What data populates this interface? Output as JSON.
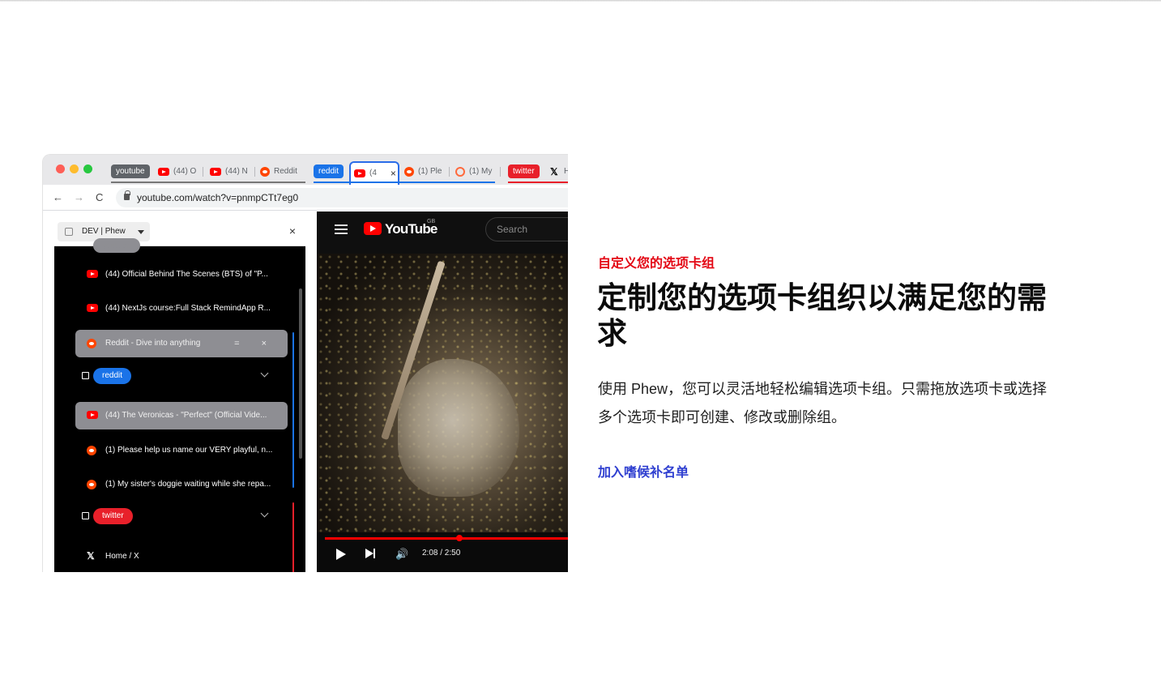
{
  "browser": {
    "tabs": [
      {
        "type": "group-chip",
        "label": "youtube",
        "color": "#555555"
      },
      {
        "type": "tab",
        "icon": "youtube-icon",
        "label": "(44) O"
      },
      {
        "type": "tab",
        "icon": "youtube-icon",
        "label": "(44) N"
      },
      {
        "type": "tab",
        "icon": "reddit-icon",
        "label": "Reddit"
      },
      {
        "type": "group-chip",
        "label": "reddit",
        "color": "#1a73e8"
      },
      {
        "type": "active-tab",
        "icon": "youtube-icon",
        "label": "(4",
        "close": "×"
      },
      {
        "type": "tab",
        "icon": "reddit-icon",
        "label": "(1) Ple"
      },
      {
        "type": "tab",
        "icon": "reddit-icon",
        "label": "(1) My"
      },
      {
        "type": "group-chip",
        "label": "twitter",
        "color": "#e8202a"
      },
      {
        "type": "tab",
        "icon": "x-icon",
        "label": "H"
      }
    ],
    "url": "youtube.com/watch?v=pnmpCTt7eg0",
    "nav": {
      "back": "←",
      "forward": "→",
      "reload": "C"
    }
  },
  "side_panel": {
    "workspace": "DEV | Phew",
    "close": "×",
    "rows": [
      {
        "icon": "youtube-icon",
        "label": "(44) Official Behind The Scenes (BTS) of \"P...",
        "highlight": false
      },
      {
        "icon": "youtube-icon",
        "label": "(44) NextJs course:Full Stack RemindApp R...",
        "highlight": false
      },
      {
        "icon": "reddit-icon",
        "label": "Reddit - Dive into anything",
        "highlight": true,
        "actions": "= ×"
      },
      {
        "icon": "youtube-icon",
        "label": "(44) The Veronicas - \"Perfect\" (Official Vide...",
        "highlight": true
      },
      {
        "icon": "reddit-icon",
        "label": "(1) Please help us name our VERY playful, n...",
        "highlight": false
      },
      {
        "icon": "reddit-icon",
        "label": "(1) My sister's doggie waiting while she repa...",
        "highlight": false
      },
      {
        "icon": "x-icon",
        "label": "Home / X",
        "highlight": false
      }
    ],
    "groups": [
      {
        "label": "youtube",
        "color": "#8e8e93"
      },
      {
        "label": "reddit",
        "color": "#1a73e8"
      },
      {
        "label": "twitter",
        "color": "#e8202a"
      }
    ]
  },
  "youtube": {
    "logo_text": "YouTube",
    "region": "GB",
    "search_placeholder": "Search",
    "time": "2:08 / 2:50",
    "progress_fraction": 0.55
  },
  "copy": {
    "eyebrow": "自定义您的选项卡组",
    "heading": "定制您的选项卡组织以满足您的需求",
    "body": "使用 Phew，您可以灵活地轻松编辑选项卡组。只需拖放选项卡或选择多个选项卡即可创建、修改或删除组。",
    "cta": "加入嗜候补名单"
  },
  "colors": {
    "accent_red": "#e30613",
    "cta_blue": "#2f3fd0",
    "youtube_red": "#ff0000"
  }
}
